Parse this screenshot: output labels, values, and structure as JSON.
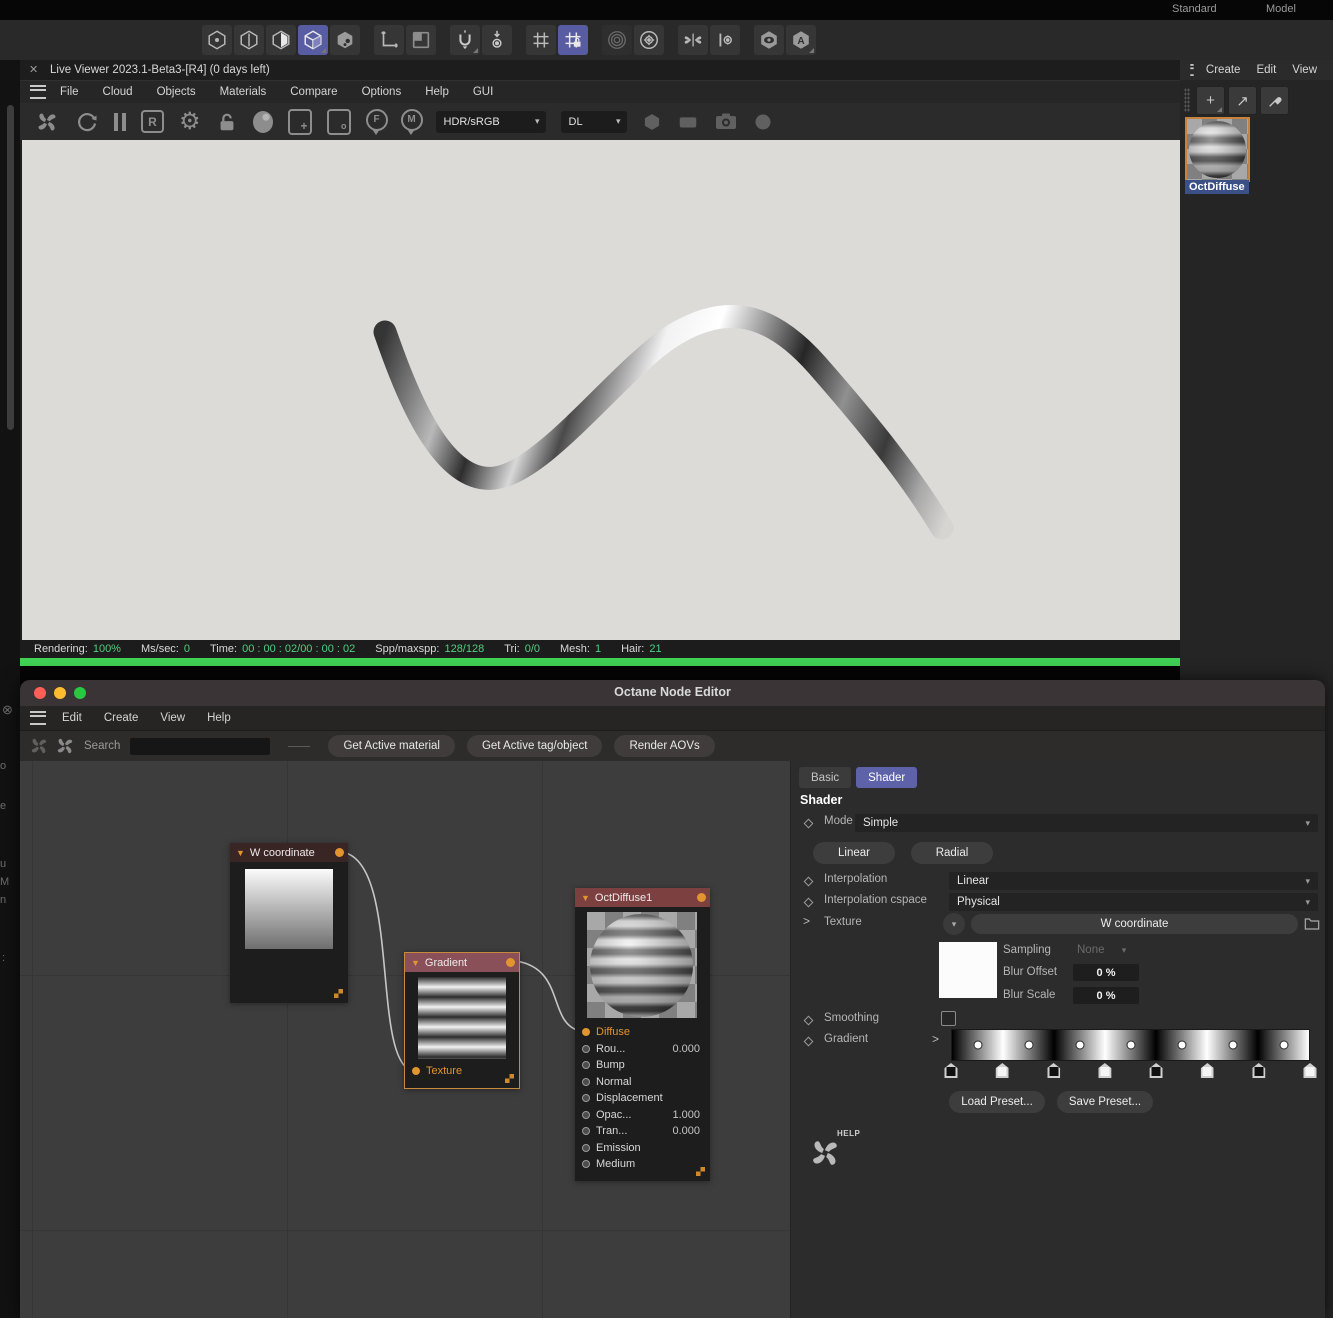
{
  "icons": {
    "close": "✕",
    "chevron_down": "▾",
    "triangle_down": "▼",
    "expand_right": ">",
    "plus": "+",
    "arrow_ne": "↗",
    "gear": "⚙",
    "grid": "#",
    "concentric": "◎",
    "wings": ")|(",
    "letter_r": "R",
    "pin_f": "F",
    "pin_m": "M",
    "dash": "—"
  },
  "top_bar": {
    "labels": [
      "Standard",
      "Model"
    ]
  },
  "live_viewer": {
    "title": "Live Viewer 2023.1-Beta3-[R4] (0 days left)",
    "menus": [
      "File",
      "Cloud",
      "Objects",
      "Materials",
      "Compare",
      "Options",
      "Help",
      "GUI"
    ],
    "toolbar": {
      "colorspace": "HDR/sRGB",
      "render_mode": "DL"
    },
    "status": [
      {
        "label": "Rendering:",
        "value": "100%"
      },
      {
        "label": "Ms/sec:",
        "value": "0"
      },
      {
        "label": "Time:",
        "value": "00 : 00 : 02/00 : 00 : 02"
      },
      {
        "label": "Spp/maxspp:",
        "value": "128/128"
      },
      {
        "label": "Tri:",
        "value": "0/0"
      },
      {
        "label": "Mesh:",
        "value": "1"
      },
      {
        "label": "Hair:",
        "value": "21"
      }
    ]
  },
  "material_panel": {
    "menus": [
      "Create",
      "Edit",
      "View"
    ],
    "material_name": "OctDiffuse"
  },
  "node_editor": {
    "title": "Octane Node Editor",
    "menus": [
      "Edit",
      "Create",
      "View",
      "Help"
    ],
    "toolbar": {
      "search_label": "Search",
      "search_value": "",
      "buttons": [
        "Get Active material",
        "Get Active tag/object",
        "Render AOVs"
      ]
    },
    "nodes": {
      "w_coordinate": {
        "title": "W coordinate"
      },
      "gradient": {
        "title": "Gradient",
        "input_label": "Texture"
      },
      "octdiffuse1": {
        "title": "OctDiffuse1",
        "rows": [
          {
            "label": "Diffuse",
            "value": ""
          },
          {
            "label": "Rou...",
            "value": "0.000"
          },
          {
            "label": "Bump",
            "value": ""
          },
          {
            "label": "Normal",
            "value": ""
          },
          {
            "label": "Displacement",
            "value": ""
          },
          {
            "label": "Opac...",
            "value": "1.000"
          },
          {
            "label": "Tran...",
            "value": "0.000"
          },
          {
            "label": "Emission",
            "value": ""
          },
          {
            "label": "Medium",
            "value": ""
          }
        ]
      }
    },
    "inspector": {
      "tabs": [
        "Basic",
        "Shader"
      ],
      "active_tab": "Shader",
      "heading": "Shader",
      "mode_label": "Mode",
      "mode_value": "Simple",
      "shape_buttons": [
        "Linear",
        "Radial"
      ],
      "interpolation_label": "Interpolation",
      "interpolation_value": "Linear",
      "cspace_label": "Interpolation cspace",
      "cspace_value": "Physical",
      "texture_label": "Texture",
      "texture_value": "W coordinate",
      "sampling_label": "Sampling",
      "sampling_value": "None",
      "blur_offset_label": "Blur Offset",
      "blur_offset_value": "0 %",
      "blur_scale_label": "Blur Scale",
      "blur_scale_value": "0 %",
      "smoothing_label": "Smoothing",
      "smoothing_checked": false,
      "gradient_label": "Gradient",
      "gradient_markers": [
        "dark",
        "light",
        "dark",
        "light",
        "dark",
        "light",
        "dark",
        "light"
      ],
      "preset_buttons": [
        "Load Preset...",
        "Save Preset..."
      ],
      "help_label": "HELP"
    }
  },
  "colors": {
    "accent_orange": "#e2942f",
    "selected_blue": "#585ca3",
    "tab_active_blue": "#5d62a9",
    "progress_green": "#40d155",
    "node_header_red": "#7d4040",
    "gradient_header_red": "#8a5059",
    "wcoord_header_red": "#3a2525",
    "name_highlight_blue": "#3a5086",
    "viewport_bg": "#dcdbd8",
    "status_value_green": "#4fd07e"
  }
}
